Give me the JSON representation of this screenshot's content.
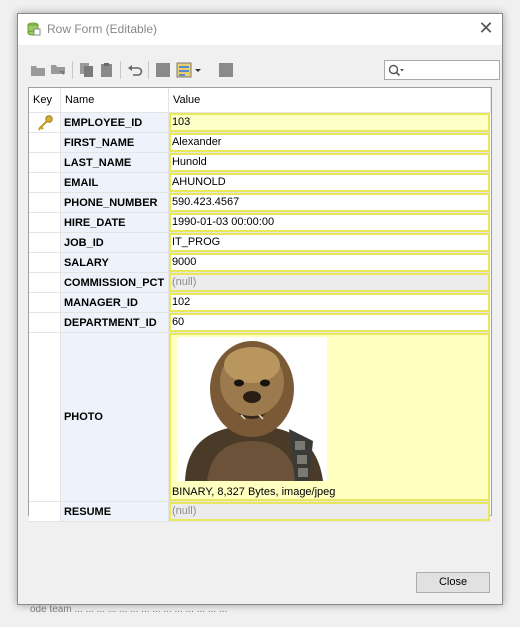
{
  "window": {
    "title": "Row Form (Editable)"
  },
  "grid": {
    "headers": {
      "key": "Key",
      "name": "Name",
      "value": "Value"
    },
    "rows": [
      {
        "name": "EMPLOYEE_ID",
        "value": "103",
        "key": true,
        "highlight": true
      },
      {
        "name": "FIRST_NAME",
        "value": "Alexander"
      },
      {
        "name": "LAST_NAME",
        "value": "Hunold"
      },
      {
        "name": "EMAIL",
        "value": "AHUNOLD"
      },
      {
        "name": "PHONE_NUMBER",
        "value": "590.423.4567"
      },
      {
        "name": "HIRE_DATE",
        "value": "1990-01-03 00:00:00"
      },
      {
        "name": "JOB_ID",
        "value": "IT_PROG"
      },
      {
        "name": "SALARY",
        "value": "9000"
      },
      {
        "name": "COMMISSION_PCT",
        "value": "(null)",
        "null": true
      },
      {
        "name": "MANAGER_ID",
        "value": "102"
      },
      {
        "name": "DEPARTMENT_ID",
        "value": "60"
      }
    ],
    "photo": {
      "name": "PHOTO",
      "caption": "BINARY, 8,327 Bytes, image/jpeg"
    },
    "resume": {
      "name": "RESUME",
      "value": "(null)"
    }
  },
  "footer": {
    "close_label": "Close"
  },
  "background_status": "ode team               ... ... ...               ... ... ... ...               ... ... ... ... ...               ... ..."
}
